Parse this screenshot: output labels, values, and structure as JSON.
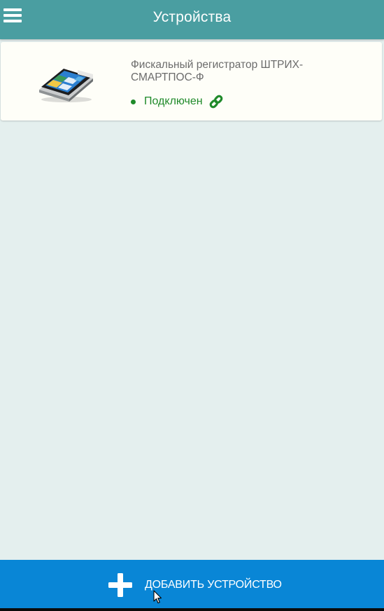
{
  "header": {
    "title": "Устройства",
    "menu_icon": "hamburger-menu-icon",
    "color": "#4a9ea1"
  },
  "devices": [
    {
      "name": "Фискальный регистратор ШТРИХ-СМАРТПОС-Ф",
      "status": "Подключен",
      "status_color": "#1f8a2a",
      "status_icon": "link-icon",
      "image": "pos-terminal-image"
    }
  ],
  "footer": {
    "add_label": "ДОБАВИТЬ УСТРОЙСТВО",
    "add_icon": "plus-icon",
    "color": "#0986d6"
  },
  "colors": {
    "background": "#e4efee",
    "card": "#fefef8"
  }
}
